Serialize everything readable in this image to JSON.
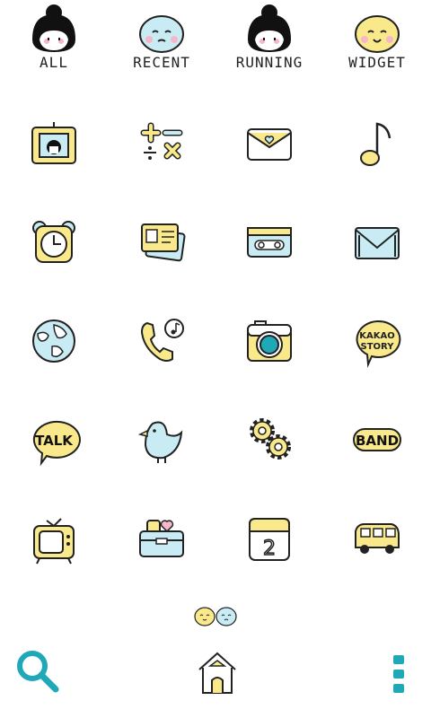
{
  "colors": {
    "yellow": "#f9e98b",
    "blue": "#c9ecf4",
    "teal": "#1fa8b8",
    "line": "#222222",
    "pink": "#f6b8c8"
  },
  "tabs": [
    {
      "label": "ALL",
      "icon": "girl-face-icon"
    },
    {
      "label": "RECENT",
      "icon": "blue-face-icon"
    },
    {
      "label": "RUNNING",
      "icon": "girl-face-icon"
    },
    {
      "label": "WIDGET",
      "icon": "yellow-face-icon"
    }
  ],
  "apps": [
    {
      "name": "photo-frame-icon"
    },
    {
      "name": "calculator-icon"
    },
    {
      "name": "message-envelope-icon"
    },
    {
      "name": "music-note-icon"
    },
    {
      "name": "alarm-clock-icon"
    },
    {
      "name": "contacts-card-icon"
    },
    {
      "name": "cassette-tape-icon"
    },
    {
      "name": "gmail-icon"
    },
    {
      "name": "globe-icon"
    },
    {
      "name": "phone-icon"
    },
    {
      "name": "camera-icon"
    },
    {
      "name": "kakaostory-icon",
      "text1": "KAKAO",
      "text2": "STORY"
    },
    {
      "name": "kakaotalk-icon",
      "text": "TALK"
    },
    {
      "name": "bird-icon"
    },
    {
      "name": "settings-gears-icon"
    },
    {
      "name": "band-icon",
      "text": "BAND"
    },
    {
      "name": "tv-icon"
    },
    {
      "name": "toolbox-icon"
    },
    {
      "name": "calendar-icon",
      "text": "2"
    },
    {
      "name": "bus-icon"
    }
  ],
  "dock": {
    "search": "search-icon",
    "home": "home-icon",
    "menu": "menu-dots-icon"
  }
}
